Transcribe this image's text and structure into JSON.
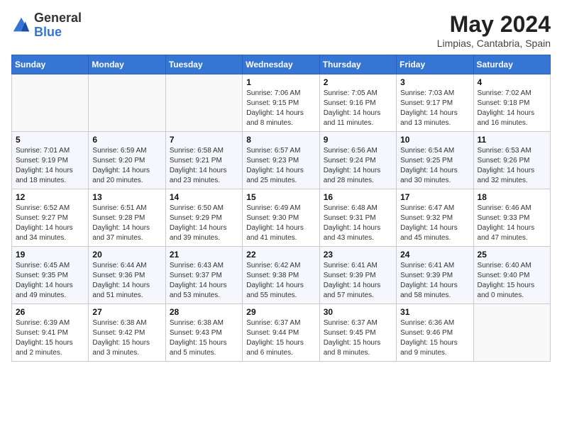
{
  "header": {
    "logo_general": "General",
    "logo_blue": "Blue",
    "title": "May 2024",
    "subtitle": "Limpias, Cantabria, Spain"
  },
  "weekdays": [
    "Sunday",
    "Monday",
    "Tuesday",
    "Wednesday",
    "Thursday",
    "Friday",
    "Saturday"
  ],
  "weeks": [
    [
      {
        "day": "",
        "info": ""
      },
      {
        "day": "",
        "info": ""
      },
      {
        "day": "",
        "info": ""
      },
      {
        "day": "1",
        "info": "Sunrise: 7:06 AM\nSunset: 9:15 PM\nDaylight: 14 hours\nand 8 minutes."
      },
      {
        "day": "2",
        "info": "Sunrise: 7:05 AM\nSunset: 9:16 PM\nDaylight: 14 hours\nand 11 minutes."
      },
      {
        "day": "3",
        "info": "Sunrise: 7:03 AM\nSunset: 9:17 PM\nDaylight: 14 hours\nand 13 minutes."
      },
      {
        "day": "4",
        "info": "Sunrise: 7:02 AM\nSunset: 9:18 PM\nDaylight: 14 hours\nand 16 minutes."
      }
    ],
    [
      {
        "day": "5",
        "info": "Sunrise: 7:01 AM\nSunset: 9:19 PM\nDaylight: 14 hours\nand 18 minutes."
      },
      {
        "day": "6",
        "info": "Sunrise: 6:59 AM\nSunset: 9:20 PM\nDaylight: 14 hours\nand 20 minutes."
      },
      {
        "day": "7",
        "info": "Sunrise: 6:58 AM\nSunset: 9:21 PM\nDaylight: 14 hours\nand 23 minutes."
      },
      {
        "day": "8",
        "info": "Sunrise: 6:57 AM\nSunset: 9:23 PM\nDaylight: 14 hours\nand 25 minutes."
      },
      {
        "day": "9",
        "info": "Sunrise: 6:56 AM\nSunset: 9:24 PM\nDaylight: 14 hours\nand 28 minutes."
      },
      {
        "day": "10",
        "info": "Sunrise: 6:54 AM\nSunset: 9:25 PM\nDaylight: 14 hours\nand 30 minutes."
      },
      {
        "day": "11",
        "info": "Sunrise: 6:53 AM\nSunset: 9:26 PM\nDaylight: 14 hours\nand 32 minutes."
      }
    ],
    [
      {
        "day": "12",
        "info": "Sunrise: 6:52 AM\nSunset: 9:27 PM\nDaylight: 14 hours\nand 34 minutes."
      },
      {
        "day": "13",
        "info": "Sunrise: 6:51 AM\nSunset: 9:28 PM\nDaylight: 14 hours\nand 37 minutes."
      },
      {
        "day": "14",
        "info": "Sunrise: 6:50 AM\nSunset: 9:29 PM\nDaylight: 14 hours\nand 39 minutes."
      },
      {
        "day": "15",
        "info": "Sunrise: 6:49 AM\nSunset: 9:30 PM\nDaylight: 14 hours\nand 41 minutes."
      },
      {
        "day": "16",
        "info": "Sunrise: 6:48 AM\nSunset: 9:31 PM\nDaylight: 14 hours\nand 43 minutes."
      },
      {
        "day": "17",
        "info": "Sunrise: 6:47 AM\nSunset: 9:32 PM\nDaylight: 14 hours\nand 45 minutes."
      },
      {
        "day": "18",
        "info": "Sunrise: 6:46 AM\nSunset: 9:33 PM\nDaylight: 14 hours\nand 47 minutes."
      }
    ],
    [
      {
        "day": "19",
        "info": "Sunrise: 6:45 AM\nSunset: 9:35 PM\nDaylight: 14 hours\nand 49 minutes."
      },
      {
        "day": "20",
        "info": "Sunrise: 6:44 AM\nSunset: 9:36 PM\nDaylight: 14 hours\nand 51 minutes."
      },
      {
        "day": "21",
        "info": "Sunrise: 6:43 AM\nSunset: 9:37 PM\nDaylight: 14 hours\nand 53 minutes."
      },
      {
        "day": "22",
        "info": "Sunrise: 6:42 AM\nSunset: 9:38 PM\nDaylight: 14 hours\nand 55 minutes."
      },
      {
        "day": "23",
        "info": "Sunrise: 6:41 AM\nSunset: 9:39 PM\nDaylight: 14 hours\nand 57 minutes."
      },
      {
        "day": "24",
        "info": "Sunrise: 6:41 AM\nSunset: 9:39 PM\nDaylight: 14 hours\nand 58 minutes."
      },
      {
        "day": "25",
        "info": "Sunrise: 6:40 AM\nSunset: 9:40 PM\nDaylight: 15 hours\nand 0 minutes."
      }
    ],
    [
      {
        "day": "26",
        "info": "Sunrise: 6:39 AM\nSunset: 9:41 PM\nDaylight: 15 hours\nand 2 minutes."
      },
      {
        "day": "27",
        "info": "Sunrise: 6:38 AM\nSunset: 9:42 PM\nDaylight: 15 hours\nand 3 minutes."
      },
      {
        "day": "28",
        "info": "Sunrise: 6:38 AM\nSunset: 9:43 PM\nDaylight: 15 hours\nand 5 minutes."
      },
      {
        "day": "29",
        "info": "Sunrise: 6:37 AM\nSunset: 9:44 PM\nDaylight: 15 hours\nand 6 minutes."
      },
      {
        "day": "30",
        "info": "Sunrise: 6:37 AM\nSunset: 9:45 PM\nDaylight: 15 hours\nand 8 minutes."
      },
      {
        "day": "31",
        "info": "Sunrise: 6:36 AM\nSunset: 9:46 PM\nDaylight: 15 hours\nand 9 minutes."
      },
      {
        "day": "",
        "info": ""
      }
    ]
  ]
}
